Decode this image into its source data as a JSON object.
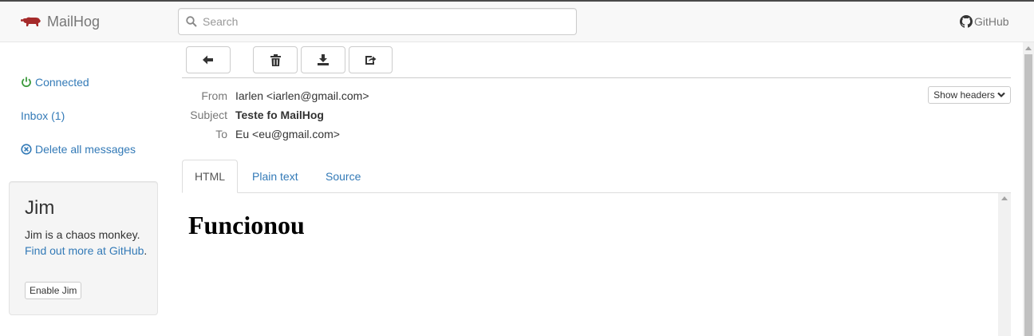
{
  "app": {
    "brand": "MailHog",
    "github_label": "GitHub"
  },
  "search": {
    "placeholder": "Search"
  },
  "sidebar": {
    "connected_label": "Connected",
    "inbox_label": "Inbox (1)",
    "delete_all_label": "Delete all messages"
  },
  "jim": {
    "title": "Jim",
    "description": "Jim is a chaos monkey.",
    "link_text": "Find out more at GitHub",
    "trailing": ".",
    "button_label": "Enable Jim"
  },
  "toolbar": {
    "icons": [
      "arrow-left-icon",
      "trash-icon",
      "download-icon",
      "share-icon"
    ]
  },
  "message": {
    "from_label": "From",
    "from_value": "Iarlen <iarlen@gmail.com>",
    "subject_label": "Subject",
    "subject_value": "Teste fo MailHog",
    "to_label": "To",
    "to_value": "Eu <eu@gmail.com>",
    "show_headers_label": "Show headers",
    "body_heading": "Funcionou"
  },
  "tabs": [
    {
      "label": "HTML",
      "active": true
    },
    {
      "label": "Plain text",
      "active": false
    },
    {
      "label": "Source",
      "active": false
    }
  ],
  "colors": {
    "link": "#337ab7",
    "connected": "#3c9a3c",
    "brand_icon": "#a52a2a",
    "navbar_bg": "#f8f8f8"
  }
}
